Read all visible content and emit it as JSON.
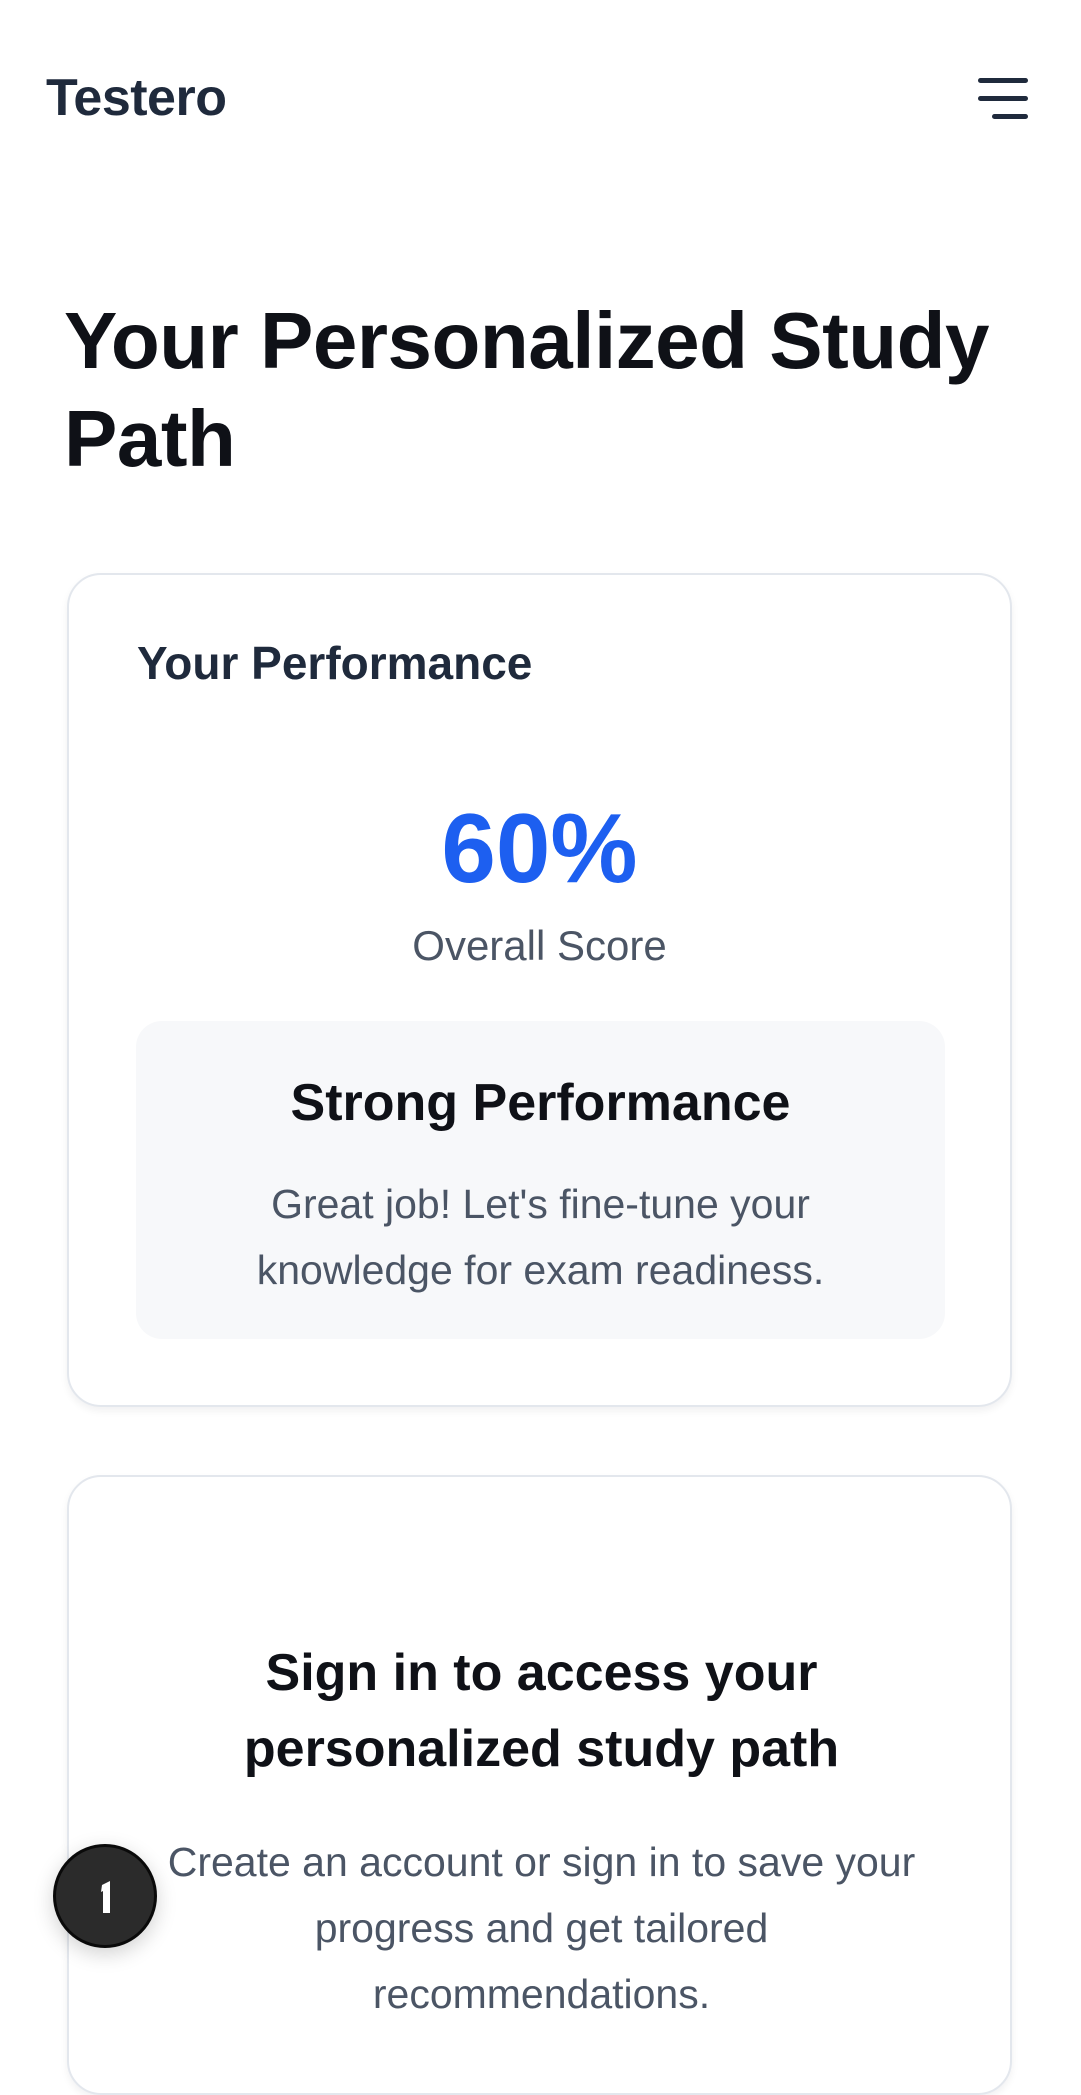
{
  "header": {
    "brand": "Testero",
    "menu_icon": "hamburger-menu-icon"
  },
  "page": {
    "title": "Your Personalized Study Path"
  },
  "performance_card": {
    "title": "Your Performance",
    "score_value": "60%",
    "score_label": "Overall Score",
    "score_color": "#1d5ff0",
    "assessment": {
      "heading": "Strong Performance",
      "message": "Great job! Let's fine-tune your knowledge for exam readiness."
    }
  },
  "signin_card": {
    "heading": "Sign in to access your personalized study path",
    "message": "Create an account or sign in to save your progress and get tailored recommendations."
  },
  "floating_button": {
    "icon": "cursor-icon"
  }
}
